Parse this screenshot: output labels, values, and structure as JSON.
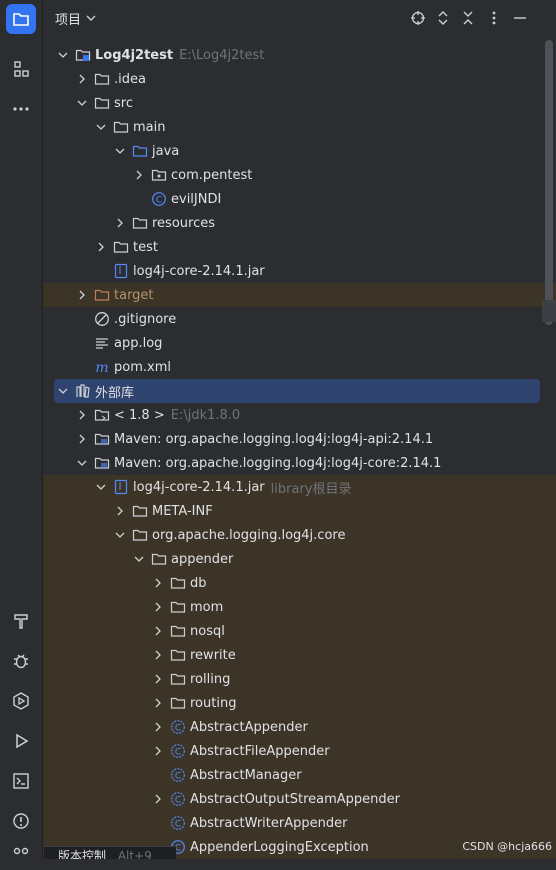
{
  "header": {
    "title": "项目"
  },
  "tree": [
    {
      "depth": 0,
      "arrow": "down",
      "icon": "module",
      "label": "Log4j2test",
      "sub": "E:\\Log4j2test",
      "bold": true
    },
    {
      "depth": 1,
      "arrow": "right",
      "icon": "folder",
      "label": ".idea"
    },
    {
      "depth": 1,
      "arrow": "down",
      "icon": "folder",
      "label": "src"
    },
    {
      "depth": 2,
      "arrow": "down",
      "icon": "folder",
      "label": "main"
    },
    {
      "depth": 3,
      "arrow": "down",
      "icon": "folder-blue",
      "label": "java"
    },
    {
      "depth": 4,
      "arrow": "right",
      "icon": "package",
      "label": "com.pentest"
    },
    {
      "depth": 4,
      "arrow": "none",
      "icon": "class",
      "label": "evilJNDI"
    },
    {
      "depth": 3,
      "arrow": "right",
      "icon": "folder",
      "label": "resources"
    },
    {
      "depth": 2,
      "arrow": "right",
      "icon": "folder",
      "label": "test"
    },
    {
      "depth": 2,
      "arrow": "none",
      "icon": "jar",
      "label": "log4j-core-2.14.1.jar"
    },
    {
      "depth": 1,
      "arrow": "right",
      "icon": "folder-orange",
      "label": "target",
      "dim": true,
      "hl": true
    },
    {
      "depth": 1,
      "arrow": "none",
      "icon": "ignore",
      "label": ".gitignore"
    },
    {
      "depth": 1,
      "arrow": "none",
      "icon": "log",
      "label": "app.log"
    },
    {
      "depth": 1,
      "arrow": "none",
      "icon": "maven",
      "label": "pom.xml"
    },
    {
      "depth": 0,
      "arrow": "down",
      "icon": "library",
      "label": "外部库",
      "sel": true
    },
    {
      "depth": 1,
      "arrow": "right",
      "icon": "sdk",
      "label": "< 1.8 >",
      "sub": "E:\\jdk1.8.0"
    },
    {
      "depth": 1,
      "arrow": "right",
      "icon": "lib",
      "label": "Maven: org.apache.logging.log4j:log4j-api:2.14.1"
    },
    {
      "depth": 1,
      "arrow": "down",
      "icon": "lib",
      "label": "Maven: org.apache.logging.log4j:log4j-core:2.14.1"
    },
    {
      "depth": 2,
      "arrow": "down",
      "icon": "jar",
      "label": "log4j-core-2.14.1.jar",
      "sub": "library根目录",
      "hl": true
    },
    {
      "depth": 3,
      "arrow": "right",
      "icon": "folder",
      "label": "META-INF",
      "hl": true
    },
    {
      "depth": 3,
      "arrow": "down",
      "icon": "folder",
      "label": "org.apache.logging.log4j.core",
      "hl": true
    },
    {
      "depth": 4,
      "arrow": "down",
      "icon": "folder",
      "label": "appender",
      "hl": true
    },
    {
      "depth": 5,
      "arrow": "right",
      "icon": "folder",
      "label": "db",
      "hl": true
    },
    {
      "depth": 5,
      "arrow": "right",
      "icon": "folder",
      "label": "mom",
      "hl": true
    },
    {
      "depth": 5,
      "arrow": "right",
      "icon": "folder",
      "label": "nosql",
      "hl": true
    },
    {
      "depth": 5,
      "arrow": "right",
      "icon": "folder",
      "label": "rewrite",
      "hl": true
    },
    {
      "depth": 5,
      "arrow": "right",
      "icon": "folder",
      "label": "rolling",
      "hl": true
    },
    {
      "depth": 5,
      "arrow": "right",
      "icon": "folder",
      "label": "routing",
      "hl": true
    },
    {
      "depth": 5,
      "arrow": "right",
      "icon": "abstract-class",
      "label": "AbstractAppender",
      "hl": true
    },
    {
      "depth": 5,
      "arrow": "right",
      "icon": "abstract-class",
      "label": "AbstractFileAppender",
      "hl": true
    },
    {
      "depth": 5,
      "arrow": "none",
      "icon": "abstract-class",
      "label": "AbstractManager",
      "hl": true
    },
    {
      "depth": 5,
      "arrow": "right",
      "icon": "abstract-class",
      "label": "AbstractOutputStreamAppender",
      "hl": true
    },
    {
      "depth": 5,
      "arrow": "none",
      "icon": "abstract-class",
      "label": "AbstractWriterAppender",
      "hl": true
    },
    {
      "depth": 5,
      "arrow": "none",
      "icon": "class",
      "label": "AppenderLoggingException",
      "hl": true
    }
  ],
  "bottom_tab": {
    "label": "版本控制",
    "shortcut": "Alt+9"
  },
  "watermark": "CSDN @hcja666"
}
